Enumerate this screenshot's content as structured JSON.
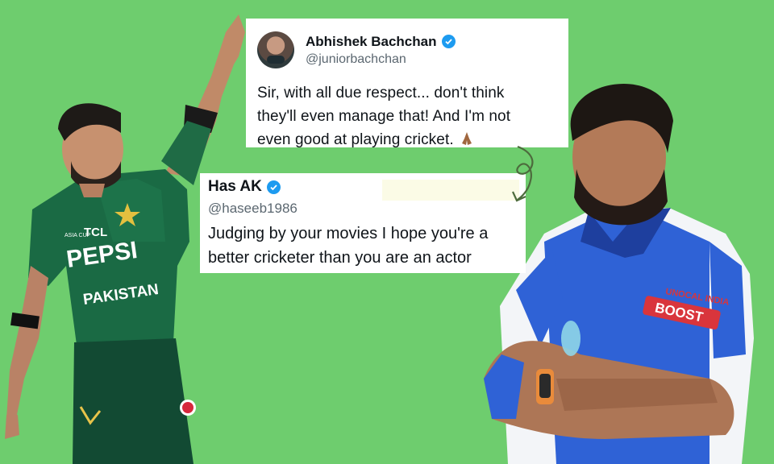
{
  "colors": {
    "background": "#6ecd6e",
    "card": "#ffffff",
    "verified": "#1d9bf0",
    "arrow": "#4d6b3d"
  },
  "tweet_top": {
    "name": "Abhishek Bachchan",
    "handle": "@juniorbachchan",
    "text_line_1": "Sir, with all due respect... don't think",
    "text_line_2": "they'll even manage that! And I'm not",
    "text_line_3": "even good at playing cricket.",
    "emoji": "folded-hands-icon"
  },
  "tweet_reply": {
    "name": "Has AK",
    "handle": "@haseeb1986",
    "text_line_1": "Judging by your movies I hope you're a",
    "text_line_2": "better cricketer than you are an actor"
  },
  "photo_left": {
    "jersey_sponsor_1": "TCL",
    "jersey_sponsor_2": "PEPSI",
    "jersey_team": "PAKISTAN",
    "jersey_badge": "ASIA CUP"
  },
  "photo_right": {
    "jersey_sponsor_1": "UNOCAL INDIA",
    "jersey_sponsor_2": "BOOST"
  }
}
